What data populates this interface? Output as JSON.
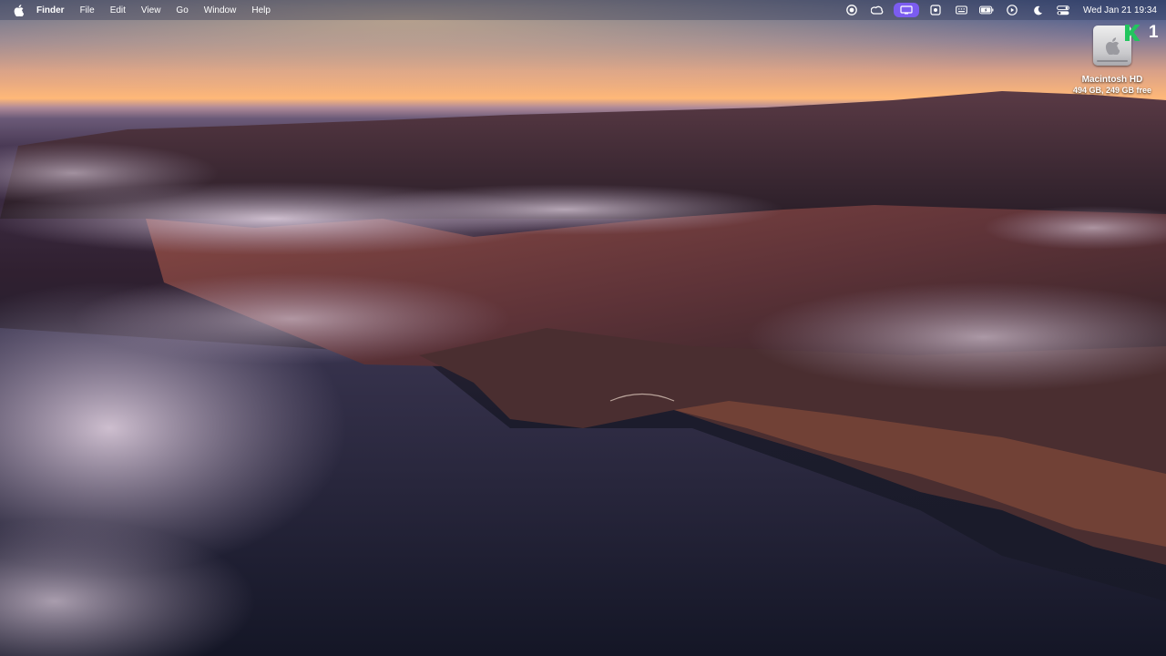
{
  "menubar": {
    "apple_icon": "apple-logo-icon",
    "items": [
      {
        "label": "Finder",
        "bold": true
      },
      {
        "label": "File"
      },
      {
        "label": "Edit"
      },
      {
        "label": "View"
      },
      {
        "label": "Go"
      },
      {
        "label": "Window"
      },
      {
        "label": "Help"
      }
    ],
    "status_icons": [
      "screen-record-icon",
      "creative-cloud-icon",
      "display-mirror-icon",
      "screenshot-tool-icon",
      "keyboard-icon",
      "battery-icon",
      "play-icon",
      "focus-moon-icon",
      "control-center-icon"
    ],
    "clock": "Wed Jan 21  19:34"
  },
  "desktop": {
    "wallpaper": "big-sur-coast",
    "drive": {
      "name": "Macintosh HD",
      "info": "494 GB, 249 GB free"
    }
  },
  "badge": {
    "letter_icon": "k-logo-icon",
    "number": "1",
    "accent": "#22c55e"
  },
  "colors": {
    "menubar_active": "#7b5cf0",
    "sky_glow": "#ffb878",
    "ocean": "#1c1c2c"
  }
}
